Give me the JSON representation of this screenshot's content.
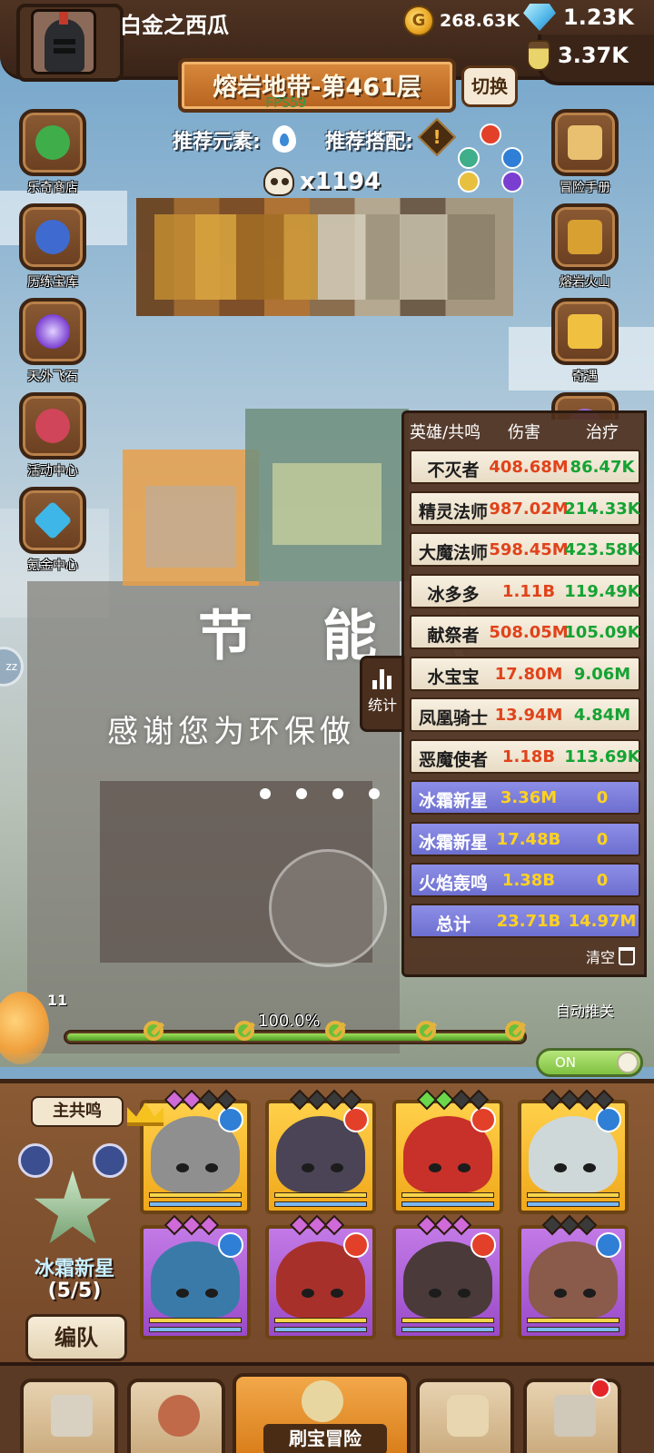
{
  "player": {
    "name": "白金之西瓜"
  },
  "resources": {
    "gold": "268.63K",
    "diamonds": "1.23K",
    "potions": "3.37K"
  },
  "stage": {
    "name": "熔岩地带-第461层",
    "fps": "FPS59",
    "switch_label": "切换"
  },
  "recommend": {
    "element_label": "推荐元素:",
    "combo_label": "推荐搭配:"
  },
  "kills": "x1194",
  "left_menu": [
    {
      "label": "乐奇商店",
      "icon": "clover-shop-icon",
      "color": "#3fae4a"
    },
    {
      "label": "历练宝库",
      "icon": "treasure-vault-icon",
      "color": "#3f6bd0"
    },
    {
      "label": "天外飞石",
      "icon": "meteor-portal-icon",
      "color": "#7a3fd0"
    },
    {
      "label": "活动中心",
      "icon": "bouquet-event-icon",
      "color": "#d0455a"
    },
    {
      "label": "氪金中心",
      "icon": "diamond-shop-icon",
      "color": "#3fb6e8"
    }
  ],
  "right_menu": [
    {
      "label": "冒险手册",
      "icon": "scroll-handbook-icon",
      "color": "#e8c070"
    },
    {
      "label": "熔岩火山",
      "icon": "volcano-chest-icon",
      "color": "#d8a030"
    },
    {
      "label": "奇遇",
      "icon": "adventure-card-icon",
      "color": "#f0c040"
    }
  ],
  "overlay": {
    "title": "节 能 (",
    "subtitle": "感谢您为环保做"
  },
  "stats": {
    "headers": {
      "hero": "英雄/共鸣",
      "damage": "伤害",
      "heal": "治疗"
    },
    "rows": [
      {
        "name": "不灭者",
        "damage": "408.68M",
        "heal": "86.47K",
        "type": "hero"
      },
      {
        "name": "精灵法师",
        "damage": "987.02M",
        "heal": "214.33K",
        "type": "hero"
      },
      {
        "name": "大魔法师",
        "damage": "598.45M",
        "heal": "423.58K",
        "type": "hero"
      },
      {
        "name": "冰多多",
        "damage": "1.11B",
        "heal": "119.49K",
        "type": "hero"
      },
      {
        "name": "献祭者",
        "damage": "508.05M",
        "heal": "105.09K",
        "type": "hero"
      },
      {
        "name": "水宝宝",
        "damage": "17.80M",
        "heal": "9.06M",
        "type": "hero"
      },
      {
        "name": "凤凰骑士",
        "damage": "13.94M",
        "heal": "4.84M",
        "type": "hero"
      },
      {
        "name": "恶魔使者",
        "damage": "1.18B",
        "heal": "113.69K",
        "type": "hero"
      },
      {
        "name": "冰霜新星",
        "damage": "3.36M",
        "heal": "0",
        "type": "frost"
      },
      {
        "name": "冰霜新星",
        "damage": "17.48B",
        "heal": "0",
        "type": "frost"
      },
      {
        "name": "火焰轰鸣",
        "damage": "1.38B",
        "heal": "0",
        "type": "frost"
      }
    ],
    "total": {
      "name": "总计",
      "damage": "23.71B",
      "heal": "14.97M"
    },
    "clear_label": "清空",
    "tab_label": "统计"
  },
  "progress": {
    "level": "11",
    "percent_label": "100.0%",
    "fraction": 1.0
  },
  "auto_advance": {
    "label": "自动推关",
    "state": "ON"
  },
  "team": {
    "resonance_label": "主共鸣",
    "name": "冰霜新星",
    "count": "(5/5)",
    "form_button": "编队"
  },
  "heroes": [
    {
      "frame": "gold",
      "element": "water",
      "portrait": "#8f8f8f",
      "gems": [
        "#d06ad8",
        "#d06ad8",
        "#3a3a3a",
        "#3a3a3a"
      ]
    },
    {
      "frame": "gold",
      "element": "fire",
      "portrait": "#4a4456",
      "gems": [
        "#3a3a3a",
        "#3a3a3a",
        "#3a3a3a",
        "#3a3a3a"
      ]
    },
    {
      "frame": "gold",
      "element": "fire",
      "portrait": "#c8302a",
      "gems": [
        "#6ad84a",
        "#6ad84a",
        "#3a3a3a",
        "#3a3a3a"
      ]
    },
    {
      "frame": "gold",
      "element": "water",
      "portrait": "#cfd8d8",
      "gems": [
        "#3a3a3a",
        "#3a3a3a",
        "#3a3a3a",
        "#3a3a3a"
      ]
    },
    {
      "frame": "purple",
      "element": "water",
      "portrait": "#3a7aa8",
      "gems": [
        "#d06ad8",
        "#d06ad8",
        "#d06ad8"
      ]
    },
    {
      "frame": "purple",
      "element": "fire",
      "portrait": "#a8302a",
      "gems": [
        "#d06ad8",
        "#d06ad8",
        "#d06ad8"
      ]
    },
    {
      "frame": "purple",
      "element": "fire",
      "portrait": "#4a3a3a",
      "gems": [
        "#d06ad8",
        "#d06ad8",
        "#d06ad8"
      ]
    },
    {
      "frame": "purple",
      "element": "water",
      "portrait": "#8a5a4a",
      "gems": [
        "#3a3a3a",
        "#3a3a3a",
        "#3a3a3a"
      ]
    }
  ],
  "nav": {
    "active_label": "刷宝冒险"
  }
}
